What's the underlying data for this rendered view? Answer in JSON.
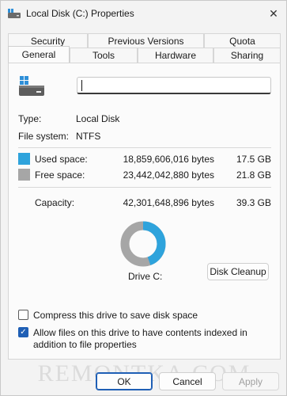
{
  "window": {
    "title": "Local Disk (C:) Properties",
    "close_glyph": "✕"
  },
  "tabs": {
    "back_row": [
      "Security",
      "Previous Versions",
      "Quota"
    ],
    "front_row": [
      "General",
      "Tools",
      "Hardware",
      "Sharing"
    ],
    "active": "General"
  },
  "general": {
    "name_value": "",
    "type_label": "Type:",
    "type_value": "Local Disk",
    "fs_label": "File system:",
    "fs_value": "NTFS",
    "used_label": "Used space:",
    "used_bytes": "18,859,606,016 bytes",
    "used_size": "17.5 GB",
    "free_label": "Free space:",
    "free_bytes": "23,442,042,880 bytes",
    "free_size": "21.8 GB",
    "capacity_label": "Capacity:",
    "capacity_bytes": "42,301,648,896 bytes",
    "capacity_size": "39.3 GB",
    "drive_label": "Drive C:",
    "cleanup_button": "Disk Cleanup",
    "compress_label": "Compress this drive to save disk space",
    "compress_checked": false,
    "index_label": "Allow files on this drive to have contents indexed in addition to file properties",
    "index_checked": true
  },
  "usage": {
    "used_fraction": 0.4458,
    "used_color": "#2ea3dc",
    "free_color": "#a6a6a6"
  },
  "footer": {
    "ok": "OK",
    "cancel": "Cancel",
    "apply": "Apply"
  },
  "watermark": "REMONTKA.COM",
  "icons": {
    "title": "drive-icon",
    "drive": "drive-icon",
    "close": "close-icon"
  }
}
